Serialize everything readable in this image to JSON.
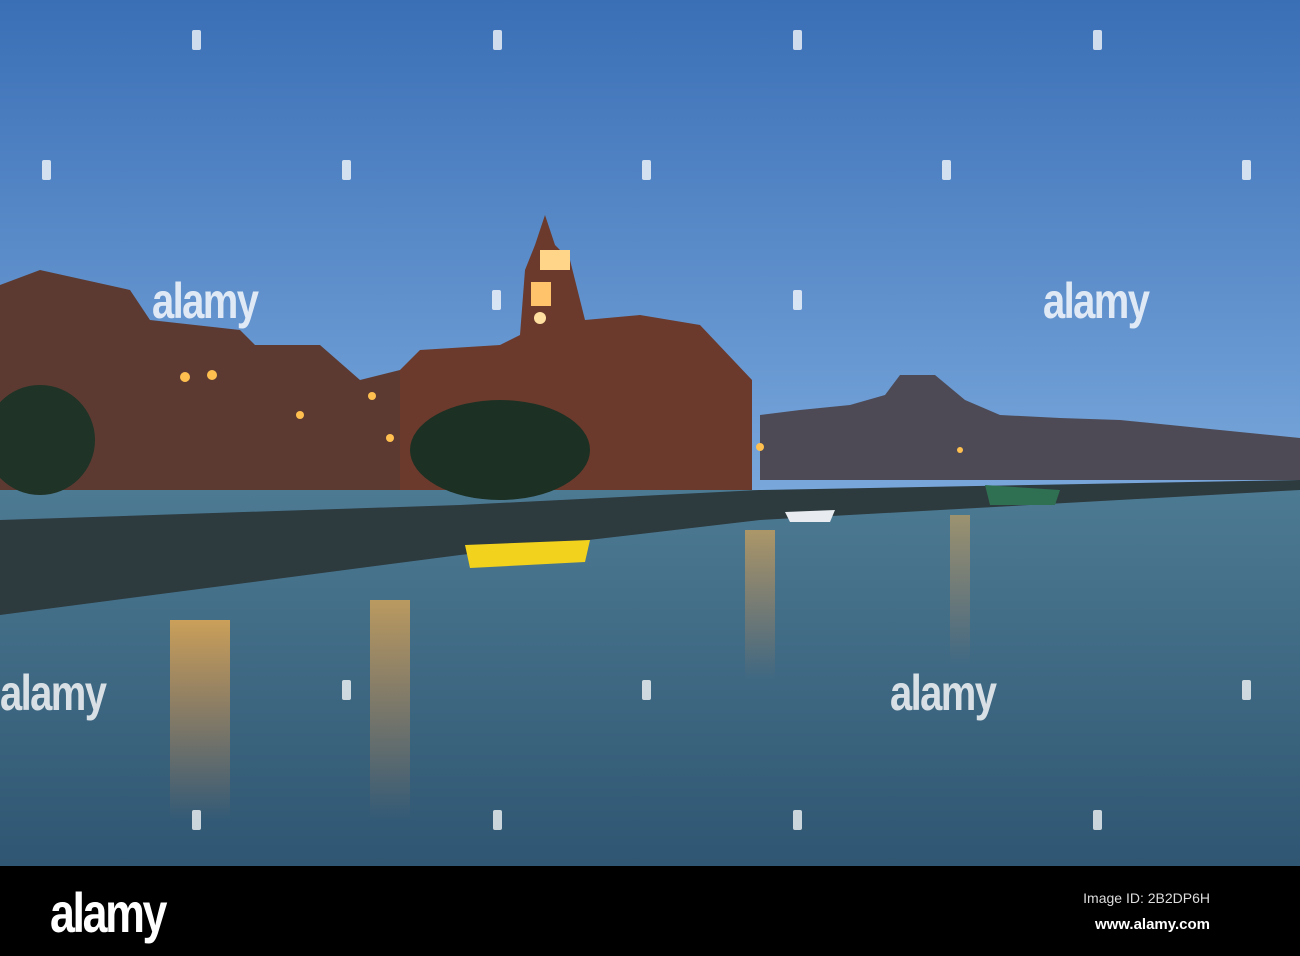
{
  "photo": {
    "subject": "Riverside town hall with clock tower at dusk",
    "colors": {
      "sky_top": "#3a6fb6",
      "sky_bottom": "#6d9fd8",
      "water": "#3f6a86",
      "brick": "#6b3a2c",
      "lights": "#ffb347"
    }
  },
  "watermark": {
    "text": "alamy"
  },
  "footer": {
    "logo": "alamy",
    "image_id": "Image ID: 2B2DP6H",
    "url": "www.alamy.com"
  }
}
